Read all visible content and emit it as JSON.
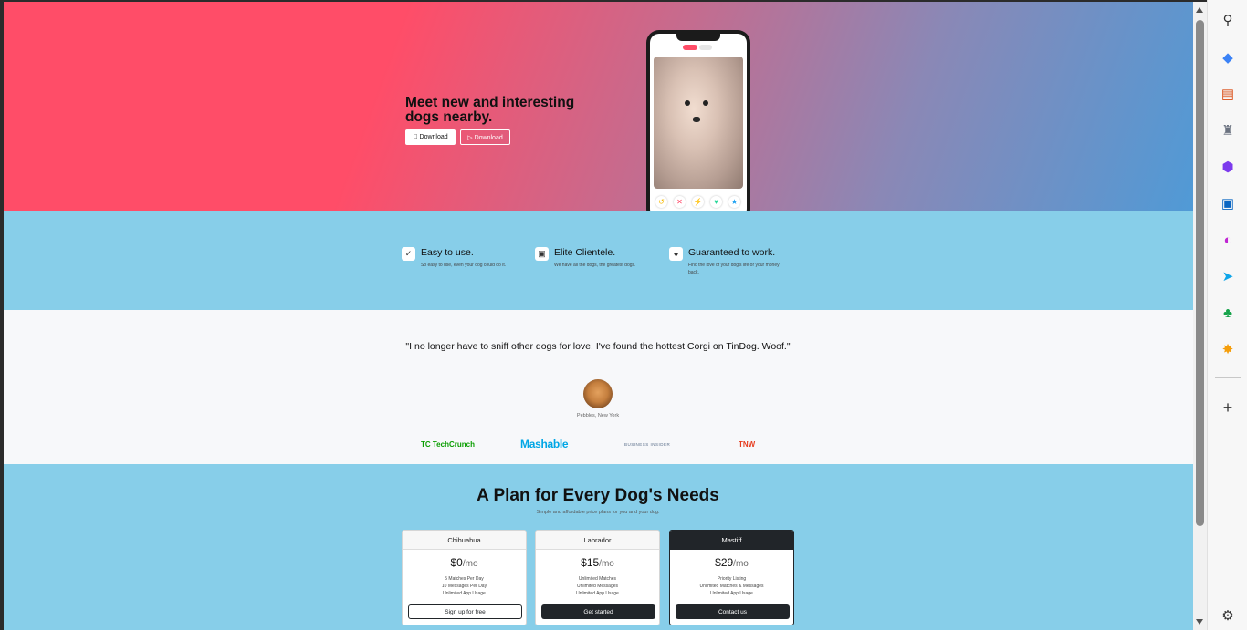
{
  "hero": {
    "title_line1": "Meet new and interesting",
    "title_line2": "dogs nearby.",
    "apple_button": " Download",
    "google_button": "▷ Download"
  },
  "features": [
    {
      "icon": "check-circle-icon",
      "glyph": "✓",
      "title": "Easy to use.",
      "desc": "So easy to use, even your dog could do it."
    },
    {
      "icon": "graduation-cap-icon",
      "glyph": "▣",
      "title": "Elite Clientele.",
      "desc": "We have all the dogs, the greatest dogs."
    },
    {
      "icon": "heart-icon",
      "glyph": "♥",
      "title": "Guaranteed to work.",
      "desc": "Find the love of your dog's life or your money back."
    }
  ],
  "testimonial": {
    "quote": "\"I no longer have to sniff other dogs for love. I've found the hottest Corgi on TinDog. Woof.\"",
    "author": "Pebbles, New York"
  },
  "press": {
    "techcrunch": "TC TechCrunch",
    "mashable": "Mashable",
    "business_insider": "BUSINESS INSIDER",
    "tnw": "TNW"
  },
  "pricing": {
    "title": "A Plan for Every Dog's Needs",
    "subtitle": "Simple and affordable price plans for you and your dog.",
    "per": "/mo",
    "plans": [
      {
        "name": "Chihuahua",
        "price": "$0",
        "features": [
          "5 Matches Per Day",
          "10 Messages Per Day",
          "Unlimited App Usage"
        ],
        "button": "Sign up for free"
      },
      {
        "name": "Labrador",
        "price": "$15",
        "features": [
          "Unlimited Matches",
          "Unlimited Messages",
          "Unlimited App Usage"
        ],
        "button": "Get started"
      },
      {
        "name": "Mastiff",
        "price": "$29",
        "features": [
          "Priority Listing",
          "Unlimited Matches & Messages",
          "Unlimited App Usage"
        ],
        "button": "Contact us"
      }
    ]
  },
  "browser_sidebar": {
    "icons": [
      "search-icon",
      "tag-icon",
      "toolbox-icon",
      "chess-icon",
      "copilot-icon",
      "outlook-icon",
      "designer-icon",
      "send-icon",
      "tree-icon",
      "game-icon",
      "add-icon",
      "settings-icon"
    ]
  },
  "colors": {
    "hero_start": "#ff4d68",
    "hero_end": "#509ad6",
    "section_blue": "#87cee9",
    "dark": "#212529"
  }
}
